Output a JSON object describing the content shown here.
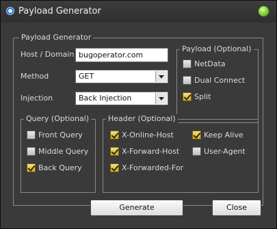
{
  "window": {
    "title": "Payload Generator",
    "app_icon": "app-icon",
    "status_color": "#7fc437"
  },
  "main": {
    "legend": "Payload Generator",
    "host_label": "Host / Domain",
    "host_value": "bugoperator.com",
    "method_label": "Method",
    "method_value": "GET",
    "injection_label": "Injection",
    "injection_value": "Back Injection"
  },
  "payload_optional": {
    "legend": "Payload (Optional)",
    "items": [
      {
        "label": "NetData",
        "checked": false
      },
      {
        "label": "Dual Connect",
        "checked": false
      },
      {
        "label": "Split",
        "checked": true
      }
    ]
  },
  "query_optional": {
    "legend": "Query (Optional)",
    "items": [
      {
        "label": "Front Query",
        "checked": false
      },
      {
        "label": "Middle Query",
        "checked": false
      },
      {
        "label": "Back Query",
        "checked": true
      }
    ]
  },
  "header_optional": {
    "legend": "Header (Optional)",
    "items": [
      {
        "label": "X-Online-Host",
        "checked": true
      },
      {
        "label": "Keep Alive",
        "checked": true
      },
      {
        "label": "X-Forward-Host",
        "checked": true
      },
      {
        "label": "User-Agent",
        "checked": false
      },
      {
        "label": "X-Forwarded-For",
        "checked": true
      }
    ]
  },
  "buttons": {
    "generate": "Generate",
    "close": "Close"
  }
}
